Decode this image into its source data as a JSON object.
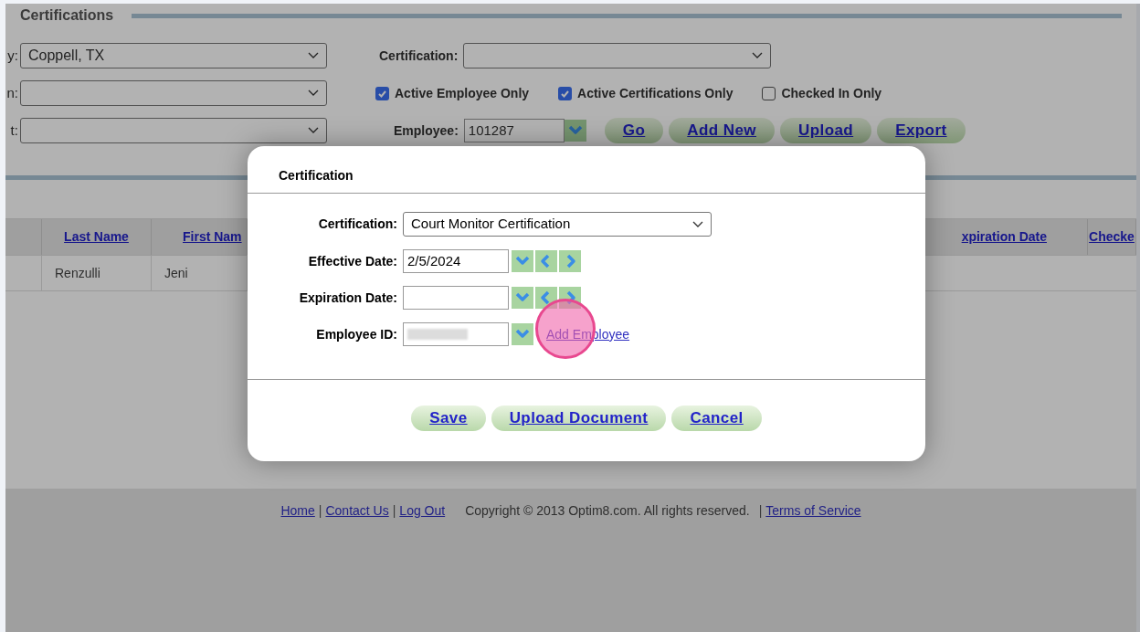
{
  "section_title": "Certifications",
  "filters_left": [
    {
      "label": "y:",
      "value": "Coppell, TX"
    },
    {
      "label": "n:"
    },
    {
      "label": "t:"
    }
  ],
  "certification_filter": {
    "label": "Certification:"
  },
  "checkboxes": [
    {
      "label": "Active Employee Only",
      "checked": true
    },
    {
      "label": "Active Certifications Only",
      "checked": true
    },
    {
      "label": "Checked In Only",
      "checked": false
    }
  ],
  "employee_filter": {
    "label": "Employee:",
    "value": "101287"
  },
  "actions": [
    "Go",
    "Add New",
    "Upload",
    "Export"
  ],
  "table": {
    "columns": [
      "Last Name",
      "First Nam",
      "xpiration Date",
      "Checke"
    ],
    "rows": [
      [
        "Renzulli",
        "Jeni"
      ]
    ]
  },
  "modal": {
    "title": "Certification",
    "fields": [
      {
        "kind": "select",
        "label": "Certification:",
        "value": "Court Monitor Certification"
      },
      {
        "kind": "date",
        "label": "Effective Date:",
        "value": "2/5/2024"
      },
      {
        "kind": "date",
        "label": "Expiration Date:"
      },
      {
        "kind": "lookup",
        "label": "Employee ID:",
        "redacted": true,
        "link": "Add Employee"
      }
    ],
    "buttons": [
      "Save",
      "Upload Document",
      "Cancel"
    ]
  },
  "footer": [
    {
      "kind": "link",
      "text": "Home"
    },
    {
      "kind": "separator",
      "text": "|"
    },
    {
      "kind": "link",
      "text": "Contact Us"
    },
    {
      "kind": "separator",
      "text": "|"
    },
    {
      "kind": "link",
      "text": "Log Out"
    },
    {
      "kind": "text",
      "text": "Copyright © 2013 Optim8.com. All rights reserved."
    },
    {
      "kind": "separator",
      "text": "|"
    },
    {
      "kind": "link",
      "text": "Terms of Service"
    }
  ]
}
